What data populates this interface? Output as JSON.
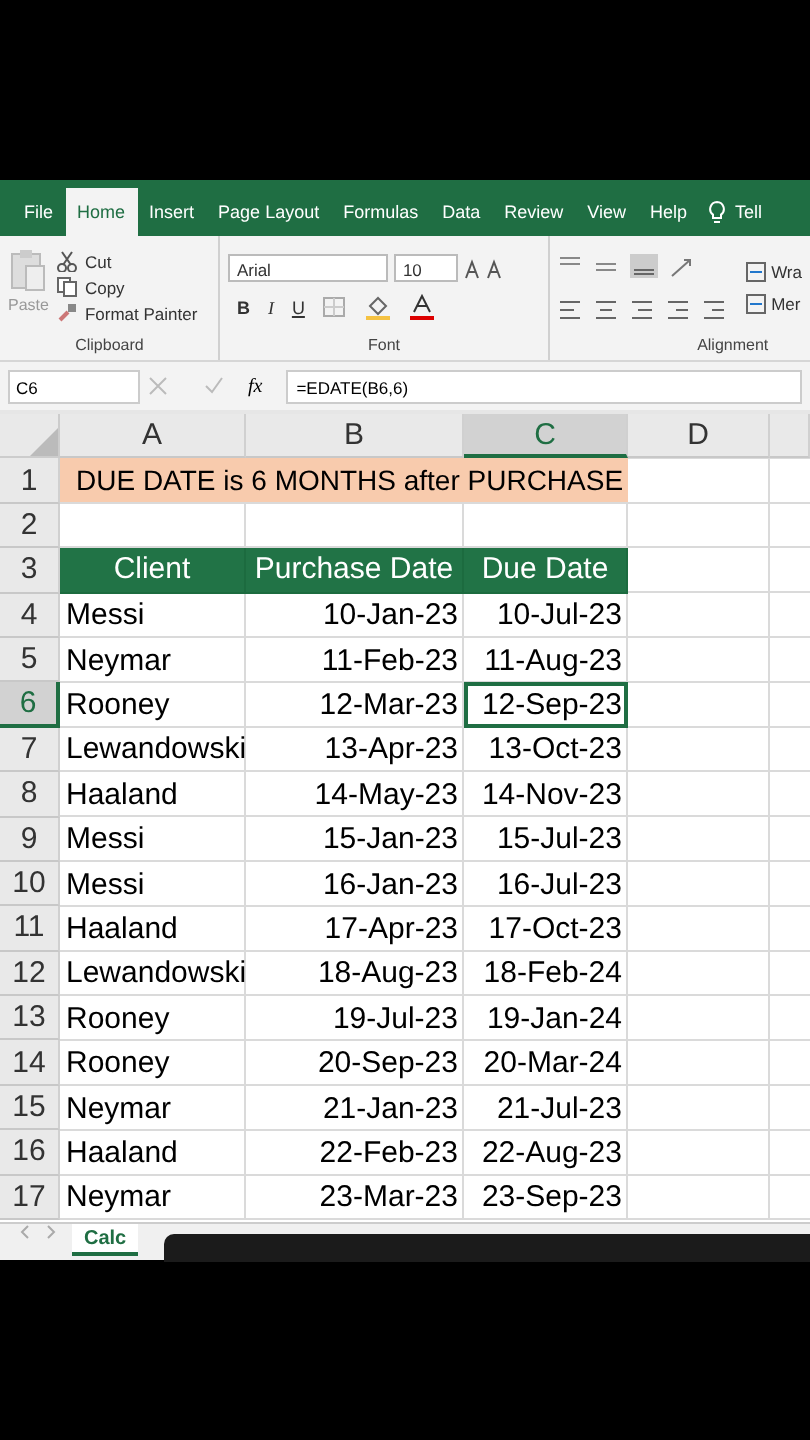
{
  "ribbon_tabs": [
    {
      "label": "File",
      "selected": false
    },
    {
      "label": "Home",
      "selected": true
    },
    {
      "label": "Insert",
      "selected": false
    },
    {
      "label": "Page Layout",
      "selected": false
    },
    {
      "label": "Formulas",
      "selected": false
    },
    {
      "label": "Data",
      "selected": false
    },
    {
      "label": "Review",
      "selected": false
    },
    {
      "label": "View",
      "selected": false
    },
    {
      "label": "Help",
      "selected": false
    }
  ],
  "tell_me": "Tell",
  "clipboard": {
    "paste": "Paste",
    "cut": "Cut",
    "copy": "Copy",
    "format_painter": "Format Painter",
    "label": "Clipboard"
  },
  "font": {
    "name": "Arial",
    "size": "10",
    "bold": "B",
    "italic": "I",
    "underline": "U",
    "label": "Font"
  },
  "alignment": {
    "wrap": "Wra",
    "merge": "Mer",
    "label": "Alignment"
  },
  "formula_bar": {
    "name_box": "C6",
    "fx": "fx",
    "formula": "=EDATE(B6,6)"
  },
  "columns": [
    {
      "label": "A",
      "selected": false
    },
    {
      "label": "B",
      "selected": false
    },
    {
      "label": "C",
      "selected": true
    },
    {
      "label": "D",
      "selected": false
    }
  ],
  "rows": [
    {
      "number": "1",
      "selected": false,
      "kind": "title",
      "cells": [
        "DUE DATE is 6 MONTHS after PURCHASE"
      ]
    },
    {
      "number": "2",
      "selected": false,
      "kind": "empty"
    },
    {
      "number": "3",
      "selected": false,
      "kind": "header",
      "cells": [
        "Client",
        "Purchase Date",
        "Due Date"
      ]
    },
    {
      "number": "4",
      "selected": false,
      "kind": "data",
      "cells": [
        "Messi",
        "10-Jan-23",
        "10-Jul-23"
      ]
    },
    {
      "number": "5",
      "selected": false,
      "kind": "data",
      "cells": [
        "Neymar",
        "11-Feb-23",
        "11-Aug-23"
      ]
    },
    {
      "number": "6",
      "selected": true,
      "kind": "data",
      "cells": [
        "Rooney",
        "12-Mar-23",
        "12-Sep-23"
      ]
    },
    {
      "number": "7",
      "selected": false,
      "kind": "data",
      "cells": [
        "Lewandowski",
        "13-Apr-23",
        "13-Oct-23"
      ]
    },
    {
      "number": "8",
      "selected": false,
      "kind": "data",
      "cells": [
        "Haaland",
        "14-May-23",
        "14-Nov-23"
      ]
    },
    {
      "number": "9",
      "selected": false,
      "kind": "data",
      "cells": [
        "Messi",
        "15-Jan-23",
        "15-Jul-23"
      ]
    },
    {
      "number": "10",
      "selected": false,
      "kind": "data",
      "cells": [
        "Messi",
        "16-Jan-23",
        "16-Jul-23"
      ]
    },
    {
      "number": "11",
      "selected": false,
      "kind": "data",
      "cells": [
        "Haaland",
        "17-Apr-23",
        "17-Oct-23"
      ]
    },
    {
      "number": "12",
      "selected": false,
      "kind": "data",
      "cells": [
        "Lewandowski",
        "18-Aug-23",
        "18-Feb-24"
      ]
    },
    {
      "number": "13",
      "selected": false,
      "kind": "data",
      "cells": [
        "Rooney",
        "19-Jul-23",
        "19-Jan-24"
      ]
    },
    {
      "number": "14",
      "selected": false,
      "kind": "data",
      "cells": [
        "Rooney",
        "20-Sep-23",
        "20-Mar-24"
      ]
    },
    {
      "number": "15",
      "selected": false,
      "kind": "data",
      "cells": [
        "Neymar",
        "21-Jan-23",
        "21-Jul-23"
      ]
    },
    {
      "number": "16",
      "selected": false,
      "kind": "data",
      "cells": [
        "Haaland",
        "22-Feb-23",
        "22-Aug-23"
      ]
    },
    {
      "number": "17",
      "selected": false,
      "kind": "data",
      "cells": [
        "Neymar",
        "23-Mar-23",
        "23-Sep-23"
      ]
    }
  ],
  "sheet_tabs": [
    {
      "label": "Calc",
      "selected": true
    }
  ]
}
